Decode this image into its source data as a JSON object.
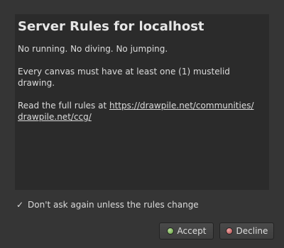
{
  "dialog": {
    "title": "Server Rules for localhost",
    "paragraphs": [
      "No running. No diving. No jumping.",
      "Every canvas must have at least one (1) mustelid drawing."
    ],
    "rules_prefix": "Read the full rules at ",
    "rules_link_line1": "https://drawpile.net/communities/",
    "rules_link_line2": "drawpile.net/ccg/",
    "checkbox_label": "Don't ask again unless the rules change",
    "checkbox_checked": true,
    "checkbox_mark": "✓",
    "accept_label": "Accept",
    "decline_label": "Decline",
    "accept_icon": "green-circle-icon",
    "decline_icon": "red-circle-icon"
  },
  "colors": {
    "window_bg": "#353535",
    "panel_bg": "#2b2b2b",
    "text": "#dcdcdc",
    "accept_icon": "#7cbb54",
    "decline_icon": "#d06a6a"
  }
}
